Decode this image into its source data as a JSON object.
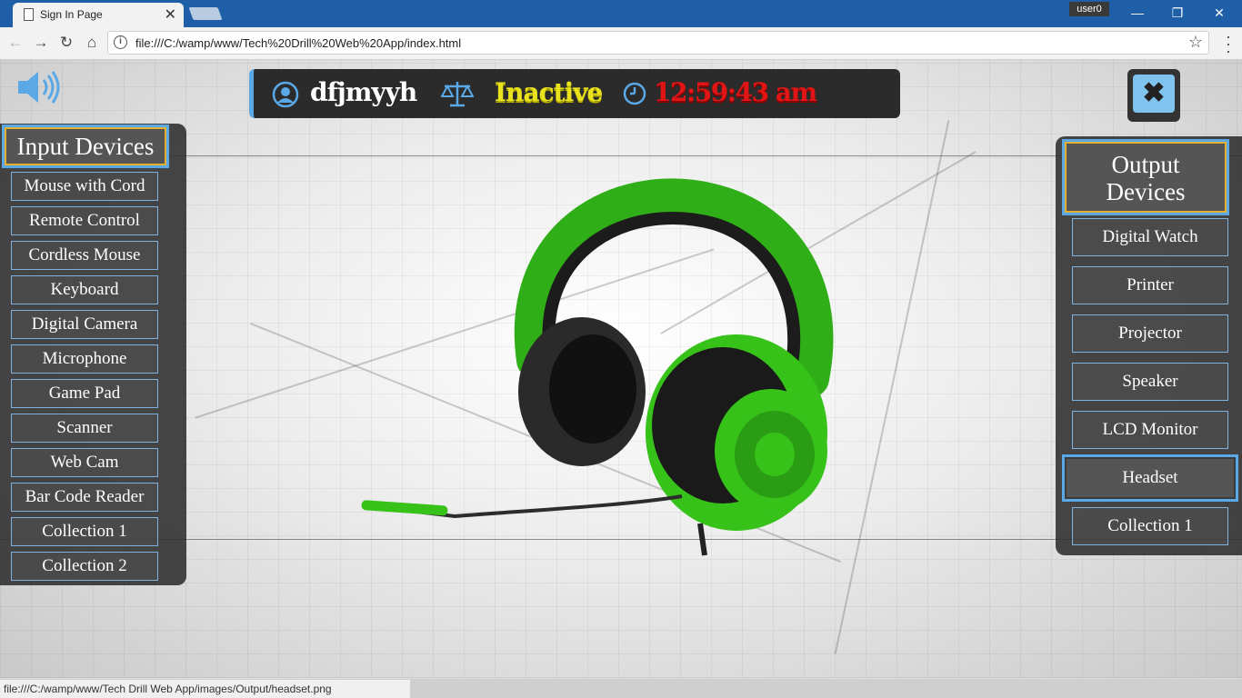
{
  "browser": {
    "tab_title": "Sign In Page",
    "tab_close": "✕",
    "user_badge": "user0",
    "minimize": "—",
    "maximize": "❐",
    "close": "✕",
    "back": "←",
    "forward": "→",
    "reload": "↻",
    "home": "⌂",
    "url": "file:///C:/wamp/www/Tech%20Drill%20Web%20App/index.html",
    "star": "☆",
    "status_url": "file:///C:/wamp/www/Tech Drill Web App/images/Output/headset.png"
  },
  "header": {
    "username": "dfjmyyh",
    "status": "Inactive",
    "clock": "12:59:43 am",
    "close_symbol": "✖"
  },
  "input_devices": {
    "heading": "Input Devices",
    "items": [
      "Mouse with Cord",
      "Remote Control",
      "Cordless Mouse",
      "Keyboard",
      "Digital Camera",
      "Microphone",
      "Game Pad",
      "Scanner",
      "Web Cam",
      "Bar Code Reader",
      "Collection 1",
      "Collection 2"
    ]
  },
  "output_devices": {
    "heading_line1": "Output",
    "heading_line2": "Devices",
    "items": [
      "Digital Watch",
      "Printer",
      "Projector",
      "Speaker",
      "LCD Monitor",
      "Headset",
      "Collection 1"
    ],
    "selected": "Headset"
  },
  "icons": {
    "speaker": "speaker-volume-icon",
    "user": "user-icon",
    "status": "balance-scale-icon",
    "clock": "clock-icon"
  },
  "colors": {
    "accent_blue": "#5aa9e6",
    "heading_border": "#e3b032",
    "status_yellow": "#e9e21c",
    "clock_red": "#e01616",
    "headset_green": "#37c21a"
  }
}
